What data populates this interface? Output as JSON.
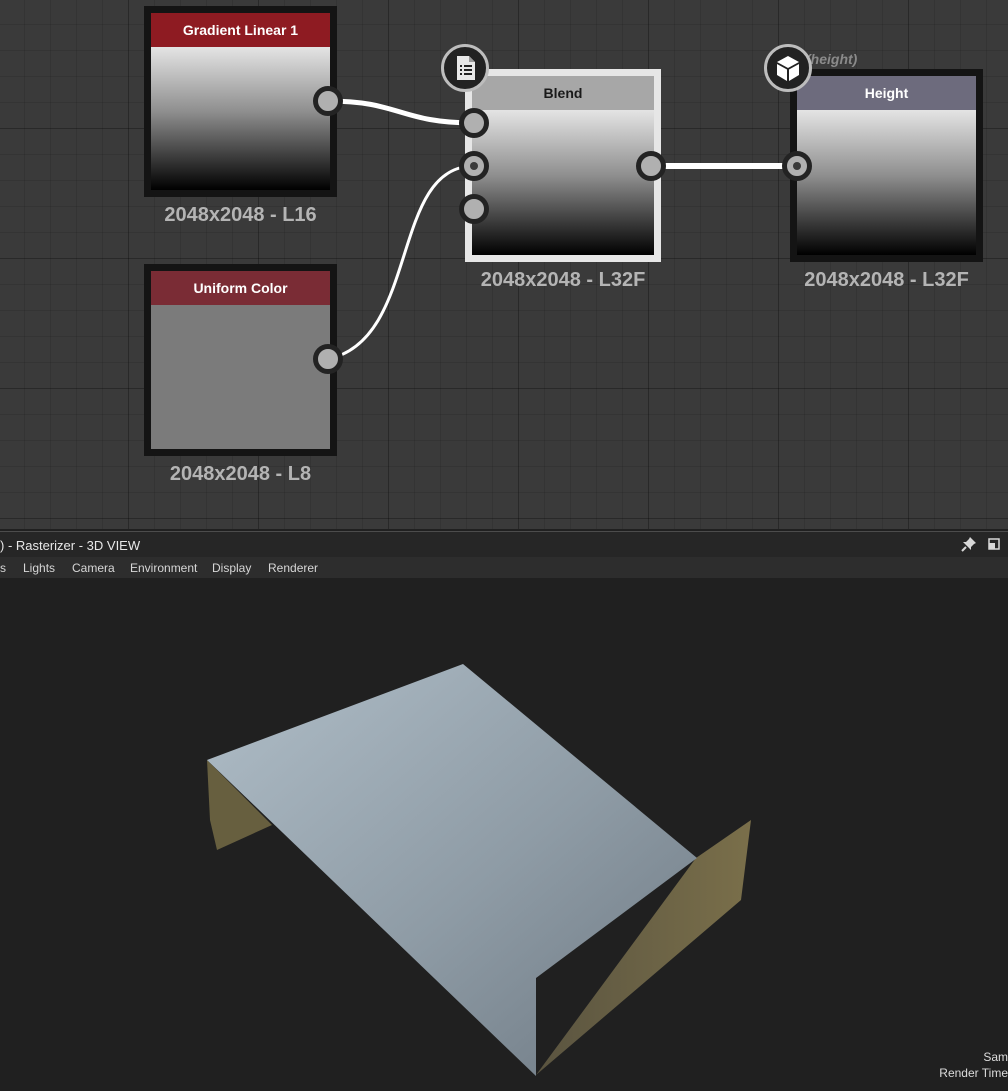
{
  "graph": {
    "nodes": [
      {
        "title": "Gradient Linear 1",
        "caption": "2048x2048 - L16",
        "header_color": "#8e1b22"
      },
      {
        "title": "Uniform Color",
        "caption": "2048x2048 - L8",
        "header_color": "#7a2c35",
        "fill_color": "#7b7b7b"
      },
      {
        "title": "Blend",
        "caption": "2048x2048 - L32F",
        "header_color": "#a7a7a7"
      },
      {
        "title": "Height",
        "caption": "2048x2048 - L32F",
        "header_color": "#6d6b7d",
        "identifier": "(height)"
      }
    ],
    "icons": {
      "blend_badge": "document-list-icon",
      "height_badge": "cube-icon"
    }
  },
  "view3d": {
    "title": ") - Rasterizer - 3D VIEW",
    "menu": [
      "s",
      "Lights",
      "Camera",
      "Environment",
      "Display",
      "Renderer"
    ],
    "pin_icon": "pin-icon",
    "restore_icon": "window-restore-icon",
    "stats": [
      "Sam",
      "Render Time"
    ],
    "colors": {
      "plane_top": "#9aa7b0",
      "plane_side": "#6e6646"
    }
  }
}
